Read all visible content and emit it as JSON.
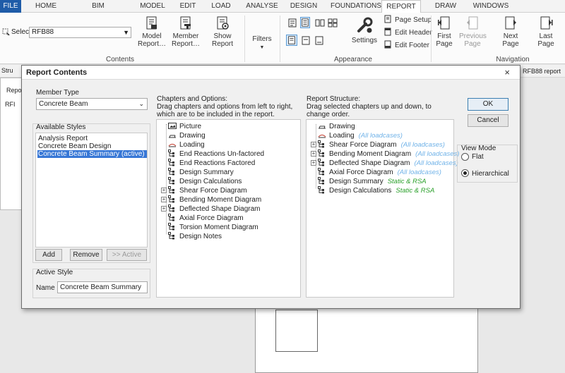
{
  "ribbon_tabs": [
    "FILE",
    "HOME",
    "BIM INTEGRATION",
    "MODEL",
    "EDIT",
    "LOAD",
    "ANALYSE",
    "DESIGN",
    "FOUNDATIONS",
    "REPORT",
    "DRAW",
    "WINDOWS"
  ],
  "active_tab": "REPORT",
  "ribbon": {
    "select_label": "Select",
    "select_value": "RFB88",
    "model_report": "Model Report…",
    "member_report": "Member Report…",
    "show_report": "Show Report",
    "filters": "Filters",
    "settings": "Settings",
    "page_setup": "Page Setup",
    "edit_header": "Edit Header",
    "edit_footer": "Edit Footer",
    "first_page": "First Page",
    "previous_page": "Previous Page",
    "next_page": "Next Page",
    "last_page": "Last Page",
    "groups": {
      "contents": "Contents",
      "appearance": "Appearance",
      "navigation": "Navigation"
    }
  },
  "background": {
    "toolbar_left": "Stru",
    "left_panel_label": "Repor",
    "left_tree_item": "RFI",
    "right_tab": "RFB88 report"
  },
  "dialog": {
    "title": "Report Contents",
    "member_type_label": "Member Type",
    "member_type_value": "Concrete Beam",
    "available_styles_label": "Available Styles",
    "styles": [
      "Analysis Report",
      "Concrete Beam Design",
      "Concrete Beam Summary (active)"
    ],
    "selected_style_index": 2,
    "add": "Add",
    "remove": "Remove",
    "active_btn": ">> Active",
    "active_style_label": "Active Style",
    "name_label": "Name",
    "name_value": "Concrete Beam Summary",
    "chapters_heading": "Chapters and Options:",
    "chapters_desc": "Drag chapters and options from left to right, which are to be included in the report.",
    "chapters": [
      {
        "label": "Picture",
        "expandable": false
      },
      {
        "label": "Drawing",
        "expandable": false
      },
      {
        "label": "Loading",
        "expandable": false
      },
      {
        "label": "End Reactions Un-factored",
        "expandable": false
      },
      {
        "label": "End Reactions Factored",
        "expandable": false
      },
      {
        "label": "Design Summary",
        "expandable": false
      },
      {
        "label": "Design Calculations",
        "expandable": false
      },
      {
        "label": "Shear Force Diagram",
        "expandable": true
      },
      {
        "label": "Bending Moment Diagram",
        "expandable": true
      },
      {
        "label": "Deflected Shape Diagram",
        "expandable": true
      },
      {
        "label": "Axial Force Diagram",
        "expandable": false
      },
      {
        "label": "Torsion Moment Diagram",
        "expandable": false
      },
      {
        "label": "Design Notes",
        "expandable": false
      }
    ],
    "structure_heading": "Report Structure:",
    "structure_desc": "Drag selected chapters up and down, to change order.",
    "structure": [
      {
        "label": "Drawing",
        "expandable": false,
        "tag": "",
        "tag_color": ""
      },
      {
        "label": "Loading",
        "expandable": false,
        "tag": "(All loadcases)",
        "tag_color": "blue"
      },
      {
        "label": "Shear Force Diagram",
        "expandable": true,
        "tag": "(All loadcases)",
        "tag_color": "blue"
      },
      {
        "label": "Bending Moment Diagram",
        "expandable": true,
        "tag": "(All loadcases)",
        "tag_color": "blue"
      },
      {
        "label": "Deflected Shape Diagram",
        "expandable": true,
        "tag": "(All loadcases)",
        "tag_color": "blue"
      },
      {
        "label": "Axial Force Diagram",
        "expandable": false,
        "tag": "(All loadcases)",
        "tag_color": "blue"
      },
      {
        "label": "Design Summary",
        "expandable": false,
        "tag": "Static & RSA",
        "tag_color": "green"
      },
      {
        "label": "Design Calculations",
        "expandable": false,
        "tag": "Static & RSA",
        "tag_color": "green"
      }
    ],
    "ok": "OK",
    "cancel": "Cancel",
    "view_mode_label": "View Mode",
    "view_flat": "Flat",
    "view_hierarchical": "Hierarchical",
    "view_mode_selected": "Hierarchical"
  },
  "colors": {
    "file_tab": "#1f5ca8",
    "selection": "#3777d6",
    "tag_blue": "#6fb2e8",
    "tag_green": "#2aa02a"
  }
}
